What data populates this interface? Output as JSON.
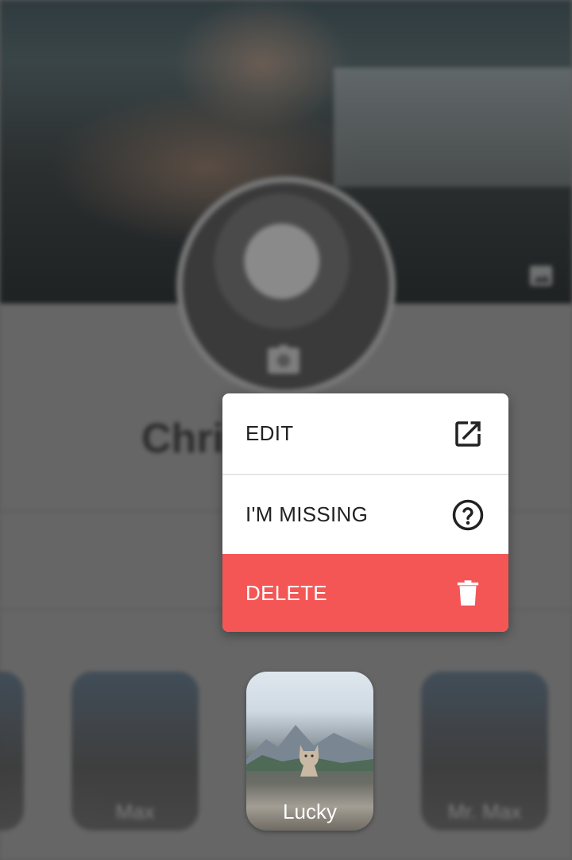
{
  "profile": {
    "name_visible": "Chri"
  },
  "menu": {
    "items": [
      {
        "label": "EDIT",
        "icon": "open-in-new-icon"
      },
      {
        "label": "I'M MISSING",
        "icon": "help-circle-icon"
      },
      {
        "label": "DELETE",
        "icon": "trash-icon"
      }
    ],
    "delete_color": "#f45656"
  },
  "pets": [
    {
      "name": ""
    },
    {
      "name": "Max"
    },
    {
      "name": "Lucky"
    },
    {
      "name": "Mr. Max"
    }
  ]
}
